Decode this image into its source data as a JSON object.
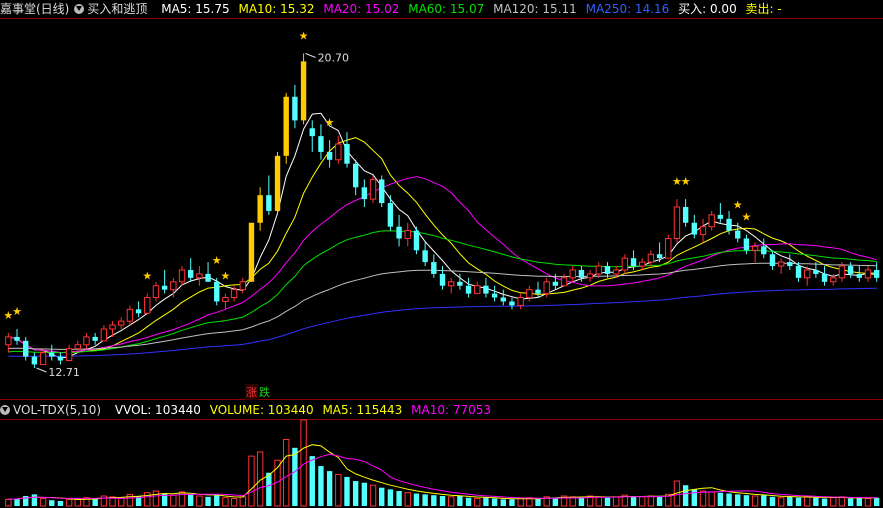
{
  "main_header": {
    "stock_name": "嘉事堂(日线)",
    "indicator": "买入和逃顶",
    "ma5": "MA5: 15.75",
    "ma10": "MA10: 15.32",
    "ma20": "MA20: 15.02",
    "ma60": "MA60: 15.07",
    "ma120": "MA120: 15.11",
    "ma250": "MA250: 14.16",
    "buy": "买入: 0.00",
    "sell": "卖出: -"
  },
  "vol_header": {
    "indicator": "VOL-TDX(5,10)",
    "vvol": "VVOL: 103440",
    "volume": "VOLUME: 103440",
    "ma5": "MA5: 115443",
    "ma10": "MA10: 77053"
  },
  "labels": {
    "high": "20.70",
    "low": "12.71",
    "up": "涨",
    "down": "跌"
  },
  "colors": {
    "up": "#ff3232",
    "down": "#54ffff",
    "ma5": "#ffffff",
    "ma10": "#ffff00",
    "ma20": "#ff00ff",
    "ma60": "#00e000",
    "ma120": "#c0c0c0",
    "ma250": "#3030ff",
    "signal": "#ffcc00",
    "grid": "#8b0000"
  },
  "chart_data": {
    "type": "candlestick",
    "price_range": [
      12.1,
      21.5
    ],
    "volume_max": 103440,
    "candles": [
      [
        13.3,
        13.6,
        13.1,
        13.5
      ],
      [
        13.5,
        13.7,
        13.3,
        13.4
      ],
      [
        13.4,
        13.5,
        12.9,
        13.0
      ],
      [
        13.0,
        13.1,
        12.71,
        12.8
      ],
      [
        12.8,
        13.2,
        12.8,
        13.1
      ],
      [
        13.1,
        13.3,
        12.9,
        13.0
      ],
      [
        13.0,
        13.1,
        12.8,
        12.9
      ],
      [
        12.9,
        13.3,
        12.9,
        13.2
      ],
      [
        13.2,
        13.4,
        13.1,
        13.3
      ],
      [
        13.3,
        13.6,
        13.2,
        13.5
      ],
      [
        13.5,
        13.6,
        13.3,
        13.4
      ],
      [
        13.4,
        13.8,
        13.4,
        13.7
      ],
      [
        13.7,
        13.9,
        13.5,
        13.8
      ],
      [
        13.8,
        14.0,
        13.7,
        13.9
      ],
      [
        13.9,
        14.3,
        13.8,
        14.2
      ],
      [
        14.2,
        14.4,
        14.0,
        14.1
      ],
      [
        14.1,
        14.6,
        14.1,
        14.5
      ],
      [
        14.5,
        14.9,
        14.4,
        14.8
      ],
      [
        14.8,
        15.2,
        14.6,
        14.7
      ],
      [
        14.7,
        15.0,
        14.5,
        14.9
      ],
      [
        14.9,
        15.3,
        14.8,
        15.2
      ],
      [
        15.2,
        15.5,
        14.9,
        15.0
      ],
      [
        15.0,
        15.3,
        14.8,
        15.1
      ],
      [
        15.1,
        15.4,
        14.9,
        14.9
      ],
      [
        14.9,
        15.0,
        14.3,
        14.4
      ],
      [
        14.4,
        14.6,
        14.2,
        14.5
      ],
      [
        14.5,
        14.8,
        14.4,
        14.7
      ],
      [
        14.7,
        15.0,
        14.6,
        14.9
      ],
      [
        14.9,
        16.4,
        14.9,
        16.4
      ],
      [
        16.4,
        17.3,
        16.2,
        17.1
      ],
      [
        17.1,
        17.6,
        16.6,
        16.7
      ],
      [
        16.7,
        18.2,
        16.6,
        18.1
      ],
      [
        18.1,
        19.7,
        17.9,
        19.6
      ],
      [
        19.6,
        19.9,
        18.8,
        19.0
      ],
      [
        19.0,
        20.7,
        18.9,
        20.5
      ],
      [
        18.8,
        19.0,
        18.2,
        18.6
      ],
      [
        18.6,
        18.9,
        18.0,
        18.2
      ],
      [
        18.2,
        18.5,
        17.8,
        18.0
      ],
      [
        18.0,
        18.6,
        17.9,
        18.4
      ],
      [
        18.4,
        18.7,
        17.8,
        17.9
      ],
      [
        17.9,
        18.0,
        17.1,
        17.3
      ],
      [
        17.3,
        17.5,
        16.8,
        17.0
      ],
      [
        17.0,
        17.6,
        16.9,
        17.5
      ],
      [
        17.5,
        17.6,
        16.8,
        16.9
      ],
      [
        16.9,
        17.1,
        16.2,
        16.3
      ],
      [
        16.3,
        16.6,
        15.8,
        16.0
      ],
      [
        16.0,
        16.4,
        15.8,
        16.2
      ],
      [
        16.2,
        16.3,
        15.6,
        15.7
      ],
      [
        15.7,
        15.9,
        15.3,
        15.4
      ],
      [
        15.4,
        15.6,
        15.0,
        15.1
      ],
      [
        15.1,
        15.3,
        14.7,
        14.8
      ],
      [
        14.8,
        15.0,
        14.6,
        14.9
      ],
      [
        14.9,
        15.1,
        14.7,
        14.8
      ],
      [
        14.8,
        15.0,
        14.5,
        14.6
      ],
      [
        14.6,
        14.9,
        14.6,
        14.8
      ],
      [
        14.8,
        15.0,
        14.5,
        14.6
      ],
      [
        14.6,
        14.8,
        14.4,
        14.5
      ],
      [
        14.5,
        14.7,
        14.3,
        14.4
      ],
      [
        14.4,
        14.5,
        14.2,
        14.3
      ],
      [
        14.3,
        14.6,
        14.2,
        14.5
      ],
      [
        14.5,
        14.8,
        14.4,
        14.7
      ],
      [
        14.7,
        14.9,
        14.5,
        14.6
      ],
      [
        14.6,
        15.0,
        14.5,
        14.9
      ],
      [
        14.9,
        15.1,
        14.7,
        14.8
      ],
      [
        14.8,
        15.1,
        14.8,
        15.0
      ],
      [
        15.0,
        15.3,
        14.9,
        15.2
      ],
      [
        15.2,
        15.3,
        14.9,
        15.0
      ],
      [
        15.0,
        15.2,
        14.9,
        15.1
      ],
      [
        15.1,
        15.4,
        15.0,
        15.3
      ],
      [
        15.3,
        15.4,
        15.0,
        15.1
      ],
      [
        15.1,
        15.3,
        15.0,
        15.2
      ],
      [
        15.2,
        15.6,
        15.1,
        15.5
      ],
      [
        15.5,
        15.7,
        15.2,
        15.3
      ],
      [
        15.3,
        15.5,
        15.2,
        15.4
      ],
      [
        15.4,
        15.7,
        15.3,
        15.6
      ],
      [
        15.6,
        15.9,
        15.4,
        15.5
      ],
      [
        15.5,
        16.1,
        15.5,
        16.0
      ],
      [
        16.0,
        17.0,
        15.9,
        16.8
      ],
      [
        16.8,
        17.0,
        16.3,
        16.4
      ],
      [
        16.4,
        16.6,
        16.0,
        16.1
      ],
      [
        16.1,
        16.5,
        15.9,
        16.3
      ],
      [
        16.3,
        16.7,
        16.2,
        16.6
      ],
      [
        16.6,
        16.9,
        16.4,
        16.5
      ],
      [
        16.5,
        16.7,
        16.1,
        16.2
      ],
      [
        16.2,
        16.4,
        15.9,
        16.0
      ],
      [
        16.0,
        16.1,
        15.6,
        15.7
      ],
      [
        15.7,
        15.9,
        15.4,
        15.8
      ],
      [
        15.8,
        16.0,
        15.5,
        15.6
      ],
      [
        15.6,
        15.7,
        15.2,
        15.3
      ],
      [
        15.3,
        15.5,
        15.1,
        15.4
      ],
      [
        15.4,
        15.6,
        15.2,
        15.3
      ],
      [
        15.3,
        15.4,
        14.9,
        15.0
      ],
      [
        15.0,
        15.3,
        14.8,
        15.2
      ],
      [
        15.2,
        15.4,
        15.0,
        15.1
      ],
      [
        15.1,
        15.3,
        14.8,
        14.9
      ],
      [
        14.9,
        15.1,
        14.8,
        15.0
      ],
      [
        15.0,
        15.4,
        14.9,
        15.3
      ],
      [
        15.3,
        15.4,
        15.0,
        15.1
      ],
      [
        15.1,
        15.3,
        14.9,
        15.0
      ],
      [
        15.0,
        15.3,
        14.9,
        15.2
      ],
      [
        15.2,
        15.4,
        14.9,
        15.0
      ]
    ],
    "volumes": [
      8000,
      9000,
      12000,
      14000,
      9000,
      7000,
      6000,
      8000,
      9000,
      10000,
      9000,
      12000,
      11000,
      10000,
      14000,
      12000,
      16000,
      18000,
      15000,
      13000,
      17000,
      14000,
      12000,
      11000,
      13000,
      10000,
      9000,
      11000,
      60000,
      65000,
      40000,
      55000,
      80000,
      70000,
      103440,
      60000,
      48000,
      42000,
      38000,
      35000,
      30000,
      28000,
      25000,
      22000,
      20000,
      18000,
      16000,
      15000,
      14000,
      13000,
      12000,
      11000,
      12000,
      10000,
      9000,
      10000,
      9000,
      8000,
      8000,
      9000,
      10000,
      9000,
      11000,
      10000,
      12000,
      11000,
      10000,
      12000,
      11000,
      10000,
      11000,
      13000,
      12000,
      11000,
      12000,
      11000,
      14000,
      30000,
      25000,
      20000,
      18000,
      17000,
      16000,
      15000,
      14000,
      13000,
      12000,
      13000,
      11000,
      10000,
      11000,
      10000,
      12000,
      10000,
      9000,
      10000,
      11000,
      9000,
      10000,
      9000,
      10000
    ],
    "signals": [
      0,
      1,
      16,
      24,
      25,
      34,
      37,
      77,
      78,
      84,
      85
    ]
  }
}
